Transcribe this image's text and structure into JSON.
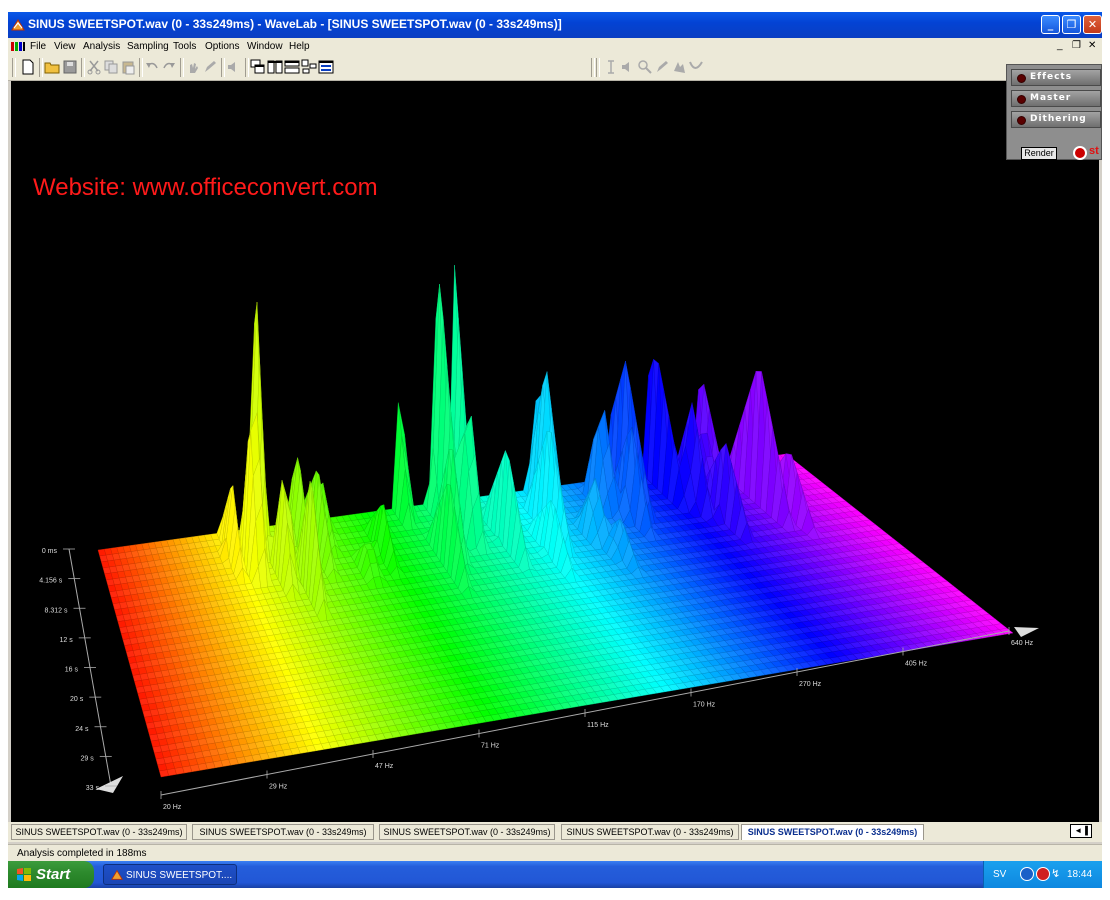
{
  "window": {
    "title": "SINUS SWEETSPOT.wav (0 - 33s249ms) - WaveLab - [SINUS SWEETSPOT.wav (0 - 33s249ms)]",
    "buttons": {
      "minimize": "_",
      "maximize": "❐",
      "close": "✕"
    }
  },
  "menu": {
    "items": [
      "File",
      "View",
      "Analysis",
      "Sampling",
      "Tools",
      "Options",
      "Window",
      "Help"
    ],
    "mdi": {
      "minimize": "_",
      "restore": "❐",
      "close": "✕"
    }
  },
  "side_panel": {
    "effects": "Effects",
    "master": "Master",
    "dithering": "Dithering",
    "render": "Render",
    "st": "st"
  },
  "watermark": "Website: www.officeconvert.com",
  "spectrum": {
    "time_labels": [
      "0 ms",
      "4.156 s",
      "8.312 s",
      "12 s",
      "16 s",
      "20 s",
      "24 s",
      "29 s",
      "33 s"
    ],
    "freq_labels": [
      "20 Hz",
      "29 Hz",
      "47 Hz",
      "71 Hz",
      "115 Hz",
      "170 Hz",
      "270 Hz",
      "405 Hz",
      "640 Hz"
    ]
  },
  "tabs": [
    {
      "label": "SINUS SWEETSPOT.wav (0 - 33s249ms)",
      "active": false
    },
    {
      "label": "SINUS SWEETSPOT.wav (0 - 33s249ms)",
      "active": false
    },
    {
      "label": "SINUS SWEETSPOT.wav (0 - 33s249ms)",
      "active": false
    },
    {
      "label": "SINUS SWEETSPOT.wav (0 - 33s249ms)",
      "active": false
    },
    {
      "label": "SINUS SWEETSPOT.wav (0 - 33s249ms)",
      "active": true
    }
  ],
  "tab_scroll": "◄▐",
  "status": "Analysis completed in 188ms",
  "taskbar": {
    "start": "Start",
    "task": "SINUS SWEETSPOT....",
    "lang": "SV",
    "clock": "18:44"
  }
}
